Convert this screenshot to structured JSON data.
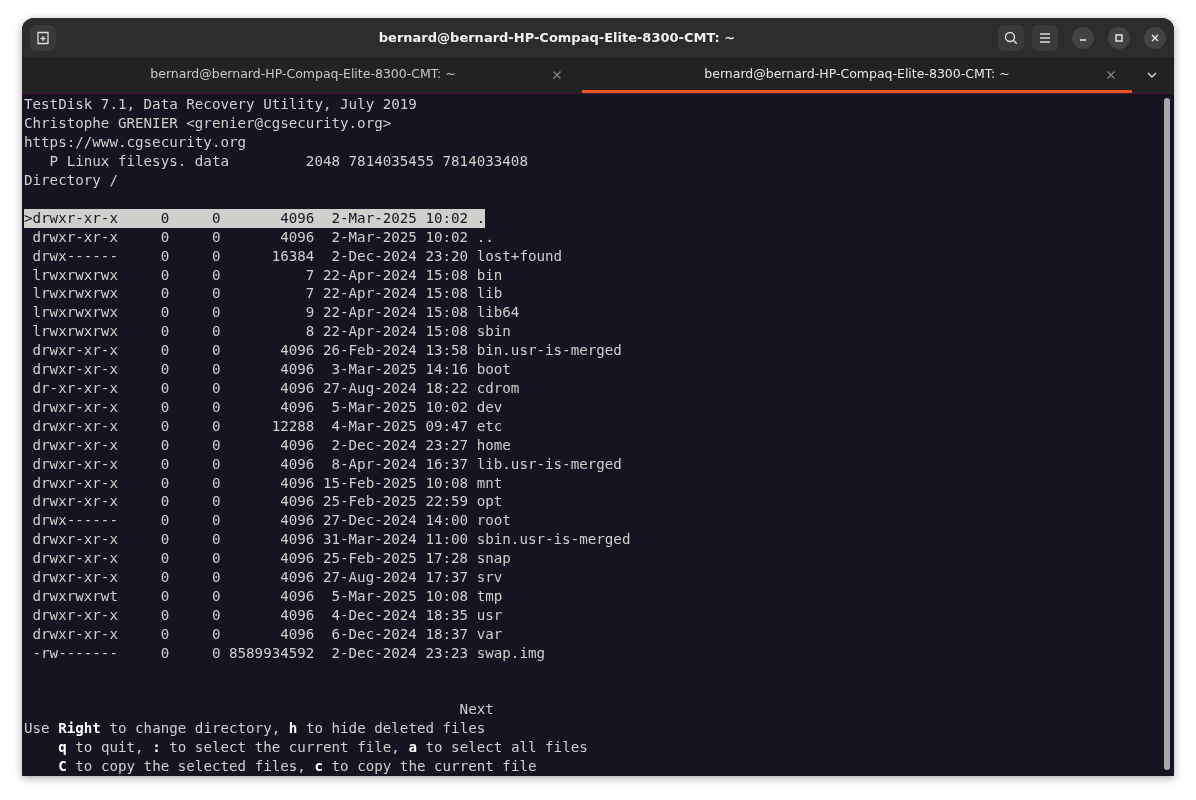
{
  "window": {
    "title": "bernard@bernard-HP-Compaq-Elite-8300-CMT: ~"
  },
  "tabs": [
    {
      "label": "bernard@bernard-HP-Compaq-Elite-8300-CMT: ~",
      "selected": false
    },
    {
      "label": "bernard@bernard-HP-Compaq-Elite-8300-CMT: ~",
      "selected": true
    }
  ],
  "terminal": {
    "header_lines": [
      "TestDisk 7.1, Data Recovery Utility, July 2019",
      "Christophe GRENIER <grenier@cgsecurity.org>",
      "https://www.cgsecurity.org",
      "   P Linux filesys. data         2048 7814035455 7814033408",
      "Directory /"
    ],
    "rows": [
      {
        "text": ">drwxr-xr-x     0     0       4096  2-Mar-2025 10:02 .",
        "selected": true
      },
      {
        "text": " drwxr-xr-x     0     0       4096  2-Mar-2025 10:02 ..",
        "selected": false
      },
      {
        "text": " drwx------     0     0      16384  2-Dec-2024 23:20 lost+found",
        "selected": false
      },
      {
        "text": " lrwxrwxrwx     0     0          7 22-Apr-2024 15:08 bin",
        "selected": false
      },
      {
        "text": " lrwxrwxrwx     0     0          7 22-Apr-2024 15:08 lib",
        "selected": false
      },
      {
        "text": " lrwxrwxrwx     0     0          9 22-Apr-2024 15:08 lib64",
        "selected": false
      },
      {
        "text": " lrwxrwxrwx     0     0          8 22-Apr-2024 15:08 sbin",
        "selected": false
      },
      {
        "text": " drwxr-xr-x     0     0       4096 26-Feb-2024 13:58 bin.usr-is-merged",
        "selected": false
      },
      {
        "text": " drwxr-xr-x     0     0       4096  3-Mar-2025 14:16 boot",
        "selected": false
      },
      {
        "text": " dr-xr-xr-x     0     0       4096 27-Aug-2024 18:22 cdrom",
        "selected": false
      },
      {
        "text": " drwxr-xr-x     0     0       4096  5-Mar-2025 10:02 dev",
        "selected": false
      },
      {
        "text": " drwxr-xr-x     0     0      12288  4-Mar-2025 09:47 etc",
        "selected": false
      },
      {
        "text": " drwxr-xr-x     0     0       4096  2-Dec-2024 23:27 home",
        "selected": false
      },
      {
        "text": " drwxr-xr-x     0     0       4096  8-Apr-2024 16:37 lib.usr-is-merged",
        "selected": false
      },
      {
        "text": " drwxr-xr-x     0     0       4096 15-Feb-2025 10:08 mnt",
        "selected": false
      },
      {
        "text": " drwxr-xr-x     0     0       4096 25-Feb-2025 22:59 opt",
        "selected": false
      },
      {
        "text": " drwx------     0     0       4096 27-Dec-2024 14:00 root",
        "selected": false
      },
      {
        "text": " drwxr-xr-x     0     0       4096 31-Mar-2024 11:00 sbin.usr-is-merged",
        "selected": false
      },
      {
        "text": " drwxr-xr-x     0     0       4096 25-Feb-2025 17:28 snap",
        "selected": false
      },
      {
        "text": " drwxr-xr-x     0     0       4096 27-Aug-2024 17:37 srv",
        "selected": false
      },
      {
        "text": " drwxrwxrwt     0     0       4096  5-Mar-2025 10:08 tmp",
        "selected": false
      },
      {
        "text": " drwxr-xr-x     0     0       4096  4-Dec-2024 18:35 usr",
        "selected": false
      },
      {
        "text": " drwxr-xr-x     0     0       4096  6-Dec-2024 18:37 var",
        "selected": false
      },
      {
        "text": " -rw-------     0     0 8589934592  2-Dec-2024 23:23 swap.img",
        "selected": false
      }
    ],
    "next": "Next",
    "help_lines": [
      "Use **Right** to change directory, **h** to hide deleted files",
      "    **q** to quit, **:** to select the current file, **a** to select all files",
      "    **C** to copy the selected files, **c** to copy the current file"
    ]
  }
}
